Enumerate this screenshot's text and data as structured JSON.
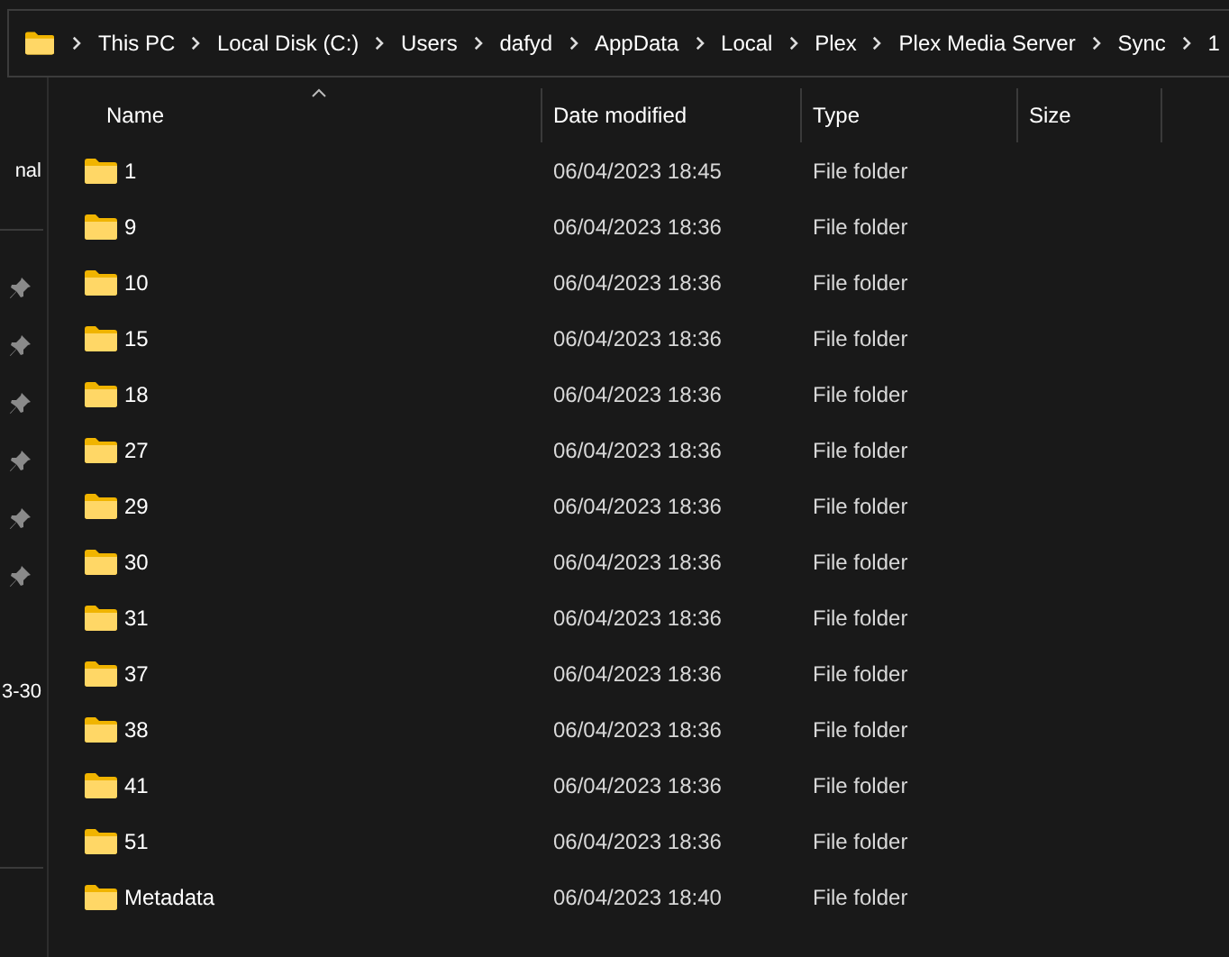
{
  "address_bar": {
    "segments": [
      "This PC",
      "Local Disk (C:)",
      "Users",
      "dafyd",
      "AppData",
      "Local",
      "Plex",
      "Plex Media Server",
      "Sync",
      "1"
    ]
  },
  "sidebar": {
    "groups": [
      [
        {
          "label": "nal",
          "pinned": false
        }
      ],
      [
        {
          "pinned": true
        },
        {
          "pinned": true
        },
        {
          "pinned": true
        },
        {
          "pinned": true
        },
        {
          "pinned": true
        },
        {
          "pinned": true
        },
        {
          "label": "3-30",
          "pinned": false
        }
      ]
    ]
  },
  "table": {
    "columns": [
      {
        "label": "Name",
        "sorted": true
      },
      {
        "label": "Date modified",
        "sorted": false
      },
      {
        "label": "Type",
        "sorted": false
      },
      {
        "label": "Size",
        "sorted": false
      }
    ],
    "rows": [
      {
        "name": "1",
        "date": "06/04/2023 18:45",
        "type": "File folder"
      },
      {
        "name": "9",
        "date": "06/04/2023 18:36",
        "type": "File folder"
      },
      {
        "name": "10",
        "date": "06/04/2023 18:36",
        "type": "File folder"
      },
      {
        "name": "15",
        "date": "06/04/2023 18:36",
        "type": "File folder"
      },
      {
        "name": "18",
        "date": "06/04/2023 18:36",
        "type": "File folder"
      },
      {
        "name": "27",
        "date": "06/04/2023 18:36",
        "type": "File folder"
      },
      {
        "name": "29",
        "date": "06/04/2023 18:36",
        "type": "File folder"
      },
      {
        "name": "30",
        "date": "06/04/2023 18:36",
        "type": "File folder"
      },
      {
        "name": "31",
        "date": "06/04/2023 18:36",
        "type": "File folder"
      },
      {
        "name": "37",
        "date": "06/04/2023 18:36",
        "type": "File folder"
      },
      {
        "name": "38",
        "date": "06/04/2023 18:36",
        "type": "File folder"
      },
      {
        "name": "41",
        "date": "06/04/2023 18:36",
        "type": "File folder"
      },
      {
        "name": "51",
        "date": "06/04/2023 18:36",
        "type": "File folder"
      },
      {
        "name": "Metadata",
        "date": "06/04/2023 18:40",
        "type": "File folder"
      }
    ]
  }
}
